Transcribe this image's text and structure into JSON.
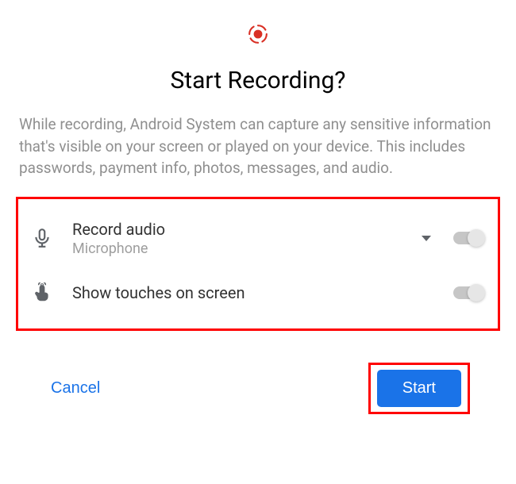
{
  "dialog": {
    "title": "Start Recording?",
    "warning": "While recording, Android System can capture any sensitive information that's visible on your screen or played on your device. This includes passwords, payment info, photos, messages, and audio."
  },
  "options": {
    "record_audio": {
      "label": "Record audio",
      "sub": "Microphone",
      "enabled": false
    },
    "show_touches": {
      "label": "Show touches on screen",
      "enabled": false
    }
  },
  "actions": {
    "cancel": "Cancel",
    "start": "Start"
  },
  "colors": {
    "accent_red": "#d93025",
    "primary_blue": "#1a73e8",
    "highlight_border": "#ff0000"
  }
}
